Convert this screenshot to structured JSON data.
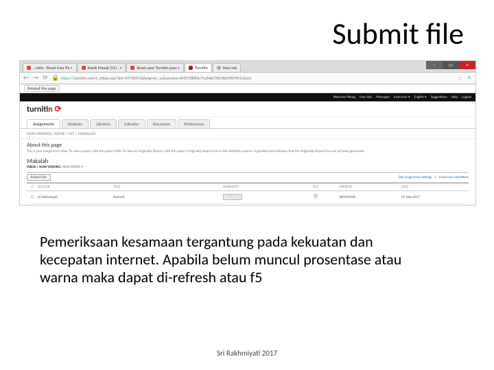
{
  "title": "Submit file",
  "body_text": "Pemeriksaan kesamaan tergantung pada kekuatan dan kecepatan internet. Apabila belum muncul prosentase atau warna maka dapat di-refresh atau f5",
  "footer": "Sri Rakhmiyati 2017",
  "browser": {
    "tabs": [
      "…mtin - Reset User Pa  ×",
      "Kotak Masuk (51) -  ×",
      "Reset your Turnitin pass  ×",
      "Turnitin",
      "New tab"
    ],
    "url_secure": "https://",
    "url_rest": "turnitin.com/t_inbox.asp?aid=39718411&lang=en_us&session-id=b7380f4c71c64dc70b76b5987451c6ae2",
    "bookmark": "Related this page",
    "win": {
      "min": "–",
      "max": "▭",
      "close": "×"
    }
  },
  "tn_top": [
    "Welcome Wong",
    "User Info",
    "Messages",
    "Instructor ▾",
    "English ▾",
    "Suggestions",
    "Help",
    "Logout"
  ],
  "logo": {
    "turn": "turnit",
    "in": "in"
  },
  "app_tabs": [
    "Assignments",
    "Students",
    "Libraries",
    "Calendar",
    "Discussion",
    "Preferences"
  ],
  "breadcrumb": "NOW VIEWING: HOME > MT > MAKALAH",
  "about": {
    "h": "About this page",
    "t": "This is your assignment inbox. To view a paper, click the paper's title. To view an Originality Report, click the paper's Originality Report icon in the similarity column. A ghosted icon indicates that the Originality Report has not yet been generated."
  },
  "mak_title": "Makalah",
  "now_viewing": {
    "label": "INBOX | NOW VIEWING:",
    "value": "NEW PAPERS ▾"
  },
  "toolbar": {
    "submit": "Submit File",
    "links": [
      "Edit assignment settings",
      "Email non-submitters"
    ]
  },
  "table": {
    "headers": {
      "chk": "☐",
      "author": "AUTHOR",
      "title": "TITLE",
      "sim": "SIMILARITY",
      "file": "FILE",
      "paper": "PAPER ID",
      "date": "DATE"
    },
    "row": {
      "chk": "☐",
      "author": "Sri Rakhmiyati",
      "title": "Android",
      "file": "🗎",
      "paper": "804344418",
      "date": "01-May-2017"
    }
  }
}
